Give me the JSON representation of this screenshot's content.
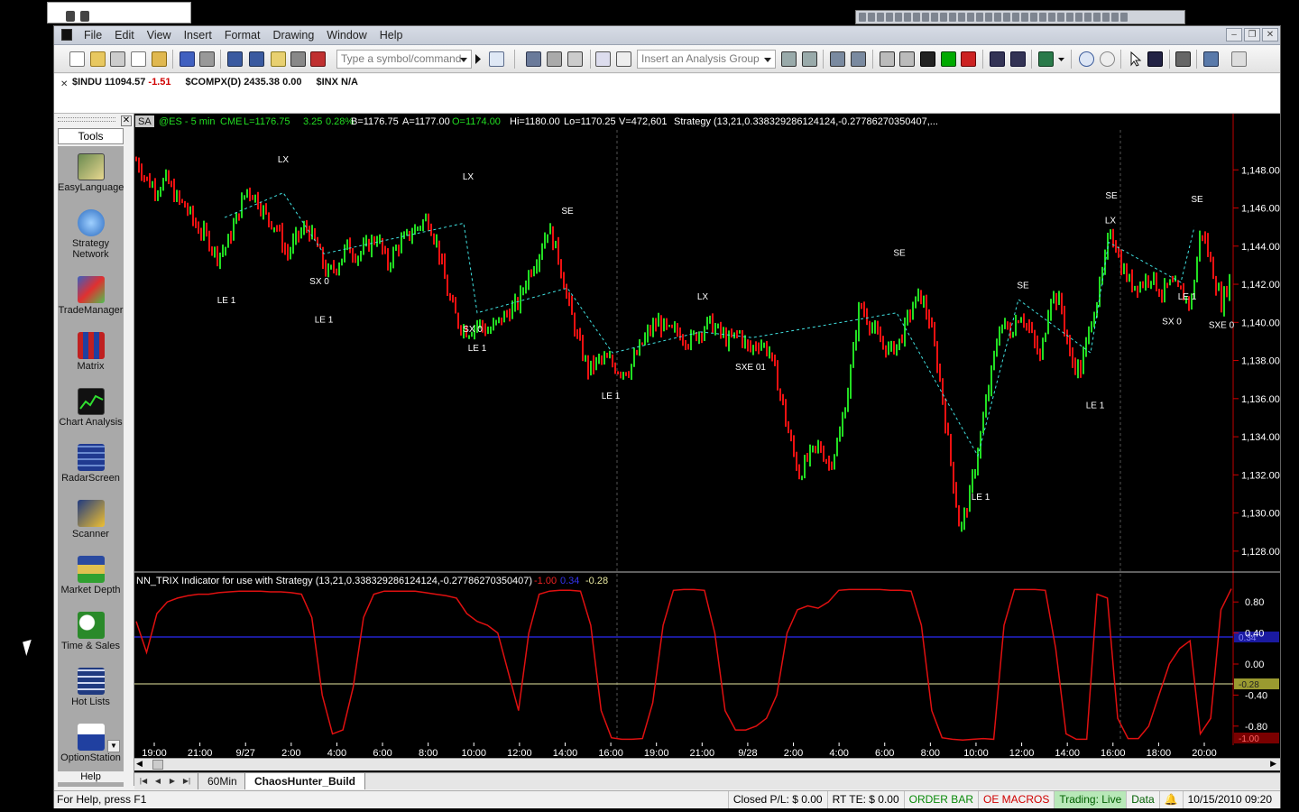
{
  "menu": [
    "File",
    "Edit",
    "View",
    "Insert",
    "Format",
    "Drawing",
    "Window",
    "Help"
  ],
  "toolbar": {
    "symbol_placeholder": "Type a symbol/command",
    "analysis_placeholder": "Insert an Analysis Group"
  },
  "quotes": {
    "indu_label": "$INDU 11094.57",
    "indu_change": "-1.51",
    "compx": "$COMPX(D) 2435.38 0.00",
    "inx": "$INX N/A"
  },
  "tools": {
    "header": "Tools",
    "items": [
      {
        "label": "EasyLanguage",
        "icon": "easylanguage-icon"
      },
      {
        "label": "Strategy Network",
        "icon": "strategy-network-icon"
      },
      {
        "label": "TradeManager",
        "icon": "trademanager-icon"
      },
      {
        "label": "Matrix",
        "icon": "matrix-icon"
      },
      {
        "label": "Chart Analysis",
        "icon": "chart-analysis-icon"
      },
      {
        "label": "RadarScreen",
        "icon": "radarscreen-icon"
      },
      {
        "label": "Scanner",
        "icon": "scanner-icon"
      },
      {
        "label": "Market Depth",
        "icon": "market-depth-icon"
      },
      {
        "label": "Time & Sales",
        "icon": "time-sales-icon"
      },
      {
        "label": "Hot Lists",
        "icon": "hot-lists-icon"
      },
      {
        "label": "OptionStation",
        "icon": "optionstation-icon"
      }
    ],
    "help": "Help"
  },
  "chart": {
    "tag": "SA",
    "header": {
      "symbol": "@ES - 5 min",
      "exchange": "CME",
      "last": "L=1176.75",
      "change": "3.25",
      "pct": "0.28%",
      "bid": "B=1176.75",
      "ask": "A=1177.00",
      "open": "O=1174.00",
      "high": "Hi=1180.00",
      "low": "Lo=1170.25",
      "volume": "V=472,601",
      "strategy": "Strategy (13,21,0.338329286124124,-0.27786270350407,..."
    },
    "indicator": {
      "title": "NN_TRIX Indicator for use with Strategy (13,21,0.338329286124124,-0.27786270350407)",
      "v1": "-1.00",
      "v2": "0.34",
      "v3": "-0.28",
      "badge_mid": "0.34",
      "badge_low": "-0.28",
      "badge_bottom": "-1.00"
    },
    "colors": {
      "up": "#22dd22",
      "down": "#ee1111",
      "trix": "#e01010",
      "upper_band": "#2222cc",
      "lower_band": "#e8e8a0",
      "axis": "#d00000",
      "signal_line": "#40e0e0"
    }
  },
  "chart_data": {
    "type": "line",
    "title": "@ES - 5 min",
    "y_ticks": [
      "1,148.00",
      "1,146.00",
      "1,144.00",
      "1,142.00",
      "1,140.00",
      "1,138.00",
      "1,136.00",
      "1,134.00",
      "1,132.00",
      "1,130.00",
      "1,128.00"
    ],
    "ylim": [
      1127,
      1150
    ],
    "indicator_ticks": [
      "0.80",
      "0.40",
      "0.00",
      "-0.40",
      "-0.80"
    ],
    "indicator_ylim": [
      -1,
      1
    ],
    "x_ticks": [
      "19:00",
      "21:00",
      "9/27",
      "2:00",
      "4:00",
      "6:00",
      "8:00",
      "10:00",
      "12:00",
      "14:00",
      "16:00",
      "19:00",
      "21:00",
      "9/28",
      "2:00",
      "4:00",
      "6:00",
      "8:00",
      "10:00",
      "12:00",
      "14:00",
      "16:00",
      "18:00",
      "20:00"
    ],
    "price_path": [
      1148.5,
      1147.5,
      1147.0,
      1147.5,
      1146.5,
      1146.0,
      1145.0,
      1144.5,
      1143.5,
      1144.0,
      1145.5,
      1147.0,
      1146.5,
      1145.5,
      1145.0,
      1143.5,
      1144.5,
      1145.0,
      1144.0,
      1142.5,
      1143.0,
      1144.0,
      1143.5,
      1144.0,
      1144.5,
      1143.0,
      1144.0,
      1144.5,
      1145.0,
      1145.5,
      1144.0,
      1141.5,
      1140.0,
      1139.5,
      1140.0,
      1139.5,
      1140.0,
      1140.5,
      1141.0,
      1142.5,
      1143.5,
      1145.0,
      1143.5,
      1141.0,
      1139.0,
      1137.5,
      1138.0,
      1138.0,
      1137.5,
      1137.5,
      1138.5,
      1139.5,
      1140.0,
      1139.5,
      1139.5,
      1139.0,
      1139.5,
      1140.0,
      1139.5,
      1139.0,
      1139.5,
      1138.5,
      1139.0,
      1138.5,
      1136.5,
      1134.0,
      1132.0,
      1133.0,
      1133.5,
      1132.5,
      1134.0,
      1137.0,
      1141.0,
      1140.0,
      1139.0,
      1138.5,
      1139.0,
      1140.5,
      1141.5,
      1140.0,
      1137.0,
      1133.0,
      1129.0,
      1131.0,
      1134.0,
      1137.0,
      1140.0,
      1139.5,
      1140.5,
      1139.5,
      1138.0,
      1141.5,
      1141.0,
      1138.0,
      1137.5,
      1140.0,
      1142.0,
      1145.0,
      1143.0,
      1142.0,
      1142.0,
      1142.5,
      1141.5,
      1142.0,
      1141.5,
      1141.0,
      1145.0,
      1143.0,
      1141.0,
      1142.5
    ],
    "trix_path": [
      0.55,
      0.15,
      0.65,
      0.8,
      0.85,
      0.88,
      0.9,
      0.9,
      0.92,
      0.93,
      0.94,
      0.94,
      0.94,
      0.93,
      0.93,
      0.92,
      0.9,
      0.6,
      -0.4,
      -0.9,
      -0.85,
      -0.3,
      0.6,
      0.9,
      0.94,
      0.94,
      0.94,
      0.94,
      0.92,
      0.9,
      0.88,
      0.85,
      0.65,
      0.55,
      0.5,
      0.4,
      -0.1,
      -0.6,
      0.4,
      0.9,
      0.94,
      0.95,
      0.95,
      0.94,
      0.5,
      -0.6,
      -0.95,
      -0.97,
      -0.97,
      -0.96,
      -0.5,
      0.5,
      0.95,
      0.96,
      0.96,
      0.95,
      0.4,
      -0.6,
      -0.85,
      -0.85,
      -0.8,
      -0.7,
      -0.4,
      0.4,
      0.7,
      0.75,
      0.72,
      0.8,
      0.95,
      0.96,
      0.96,
      0.96,
      0.96,
      0.95,
      0.95,
      0.94,
      0.5,
      -0.6,
      -0.95,
      -0.97,
      -0.98,
      -0.97,
      -0.96,
      -0.97,
      0.5,
      0.96,
      0.96,
      0.96,
      0.95,
      0.2,
      -0.9,
      -0.97,
      -0.97,
      0.9,
      0.85,
      -0.7,
      -0.96,
      -0.96,
      -0.8,
      -0.4,
      0.0,
      0.2,
      0.3,
      -0.9,
      -0.7,
      0.7,
      0.97
    ],
    "signals": [
      "LE 1",
      "LX",
      "SE",
      "SX 0",
      "LE 1",
      "LE 1",
      "LX",
      "SE",
      "SX 0",
      "LE 1",
      "SE",
      "LE 1",
      "LX",
      "SE",
      "SXE 01",
      "SE",
      "LE 1",
      "SE",
      "LE 1",
      "SE",
      "LX",
      "SX 0",
      "LE 1",
      "SE",
      "SXE 0"
    ]
  },
  "sheet_tabs": [
    "60Min",
    "ChaosHunter_Build"
  ],
  "status": {
    "help": "For Help, press F1",
    "closed_pl": "Closed P/L: $ 0.00",
    "rt_te": "RT TE: $ 0.00",
    "order_bar": "ORDER BAR",
    "oe_macros": "OE MACROS",
    "trading": "Trading: Live",
    "data": "Data",
    "datetime": "10/15/2010 09:20"
  }
}
